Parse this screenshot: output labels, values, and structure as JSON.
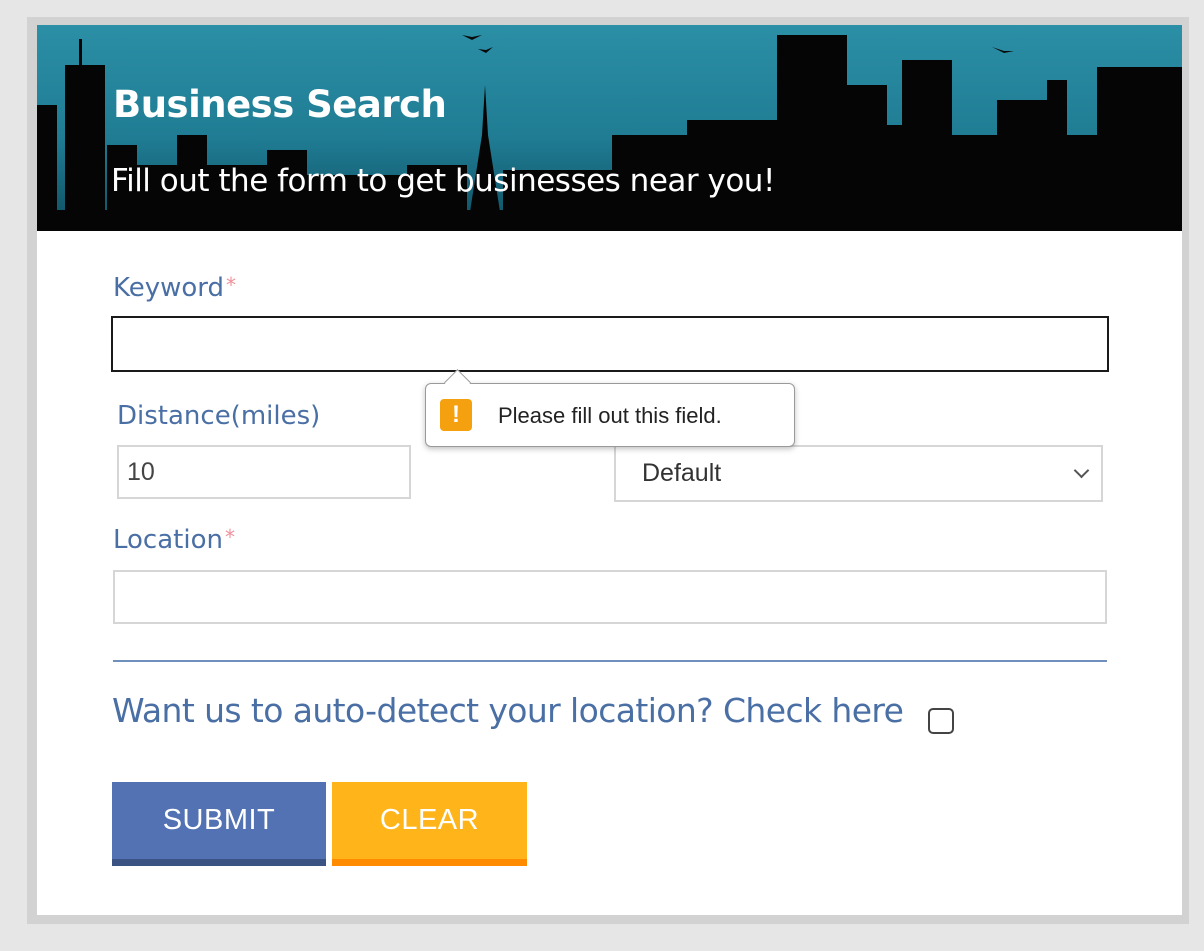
{
  "header": {
    "title": "Business Search",
    "subtitle": "Fill out the form to get businesses near you!"
  },
  "form": {
    "keyword": {
      "label": "Keyword",
      "required_mark": "*",
      "value": ""
    },
    "distance": {
      "label": "Distance(miles)",
      "value": "10"
    },
    "category": {
      "selected": "Default"
    },
    "location": {
      "label": "Location",
      "required_mark": "*",
      "value": ""
    },
    "auto_detect": {
      "label": "Want us to auto-detect your location? Check here",
      "checked": false
    },
    "submit_label": "SUBMIT",
    "clear_label": "CLEAR"
  },
  "tooltip": {
    "icon": "warning-icon",
    "message": "Please fill out this field."
  },
  "colors": {
    "label": "#4a6fa5",
    "required": "#f0909a",
    "submit": "#5272b3",
    "clear": "#ffb51a",
    "warning": "#f5a00e"
  }
}
